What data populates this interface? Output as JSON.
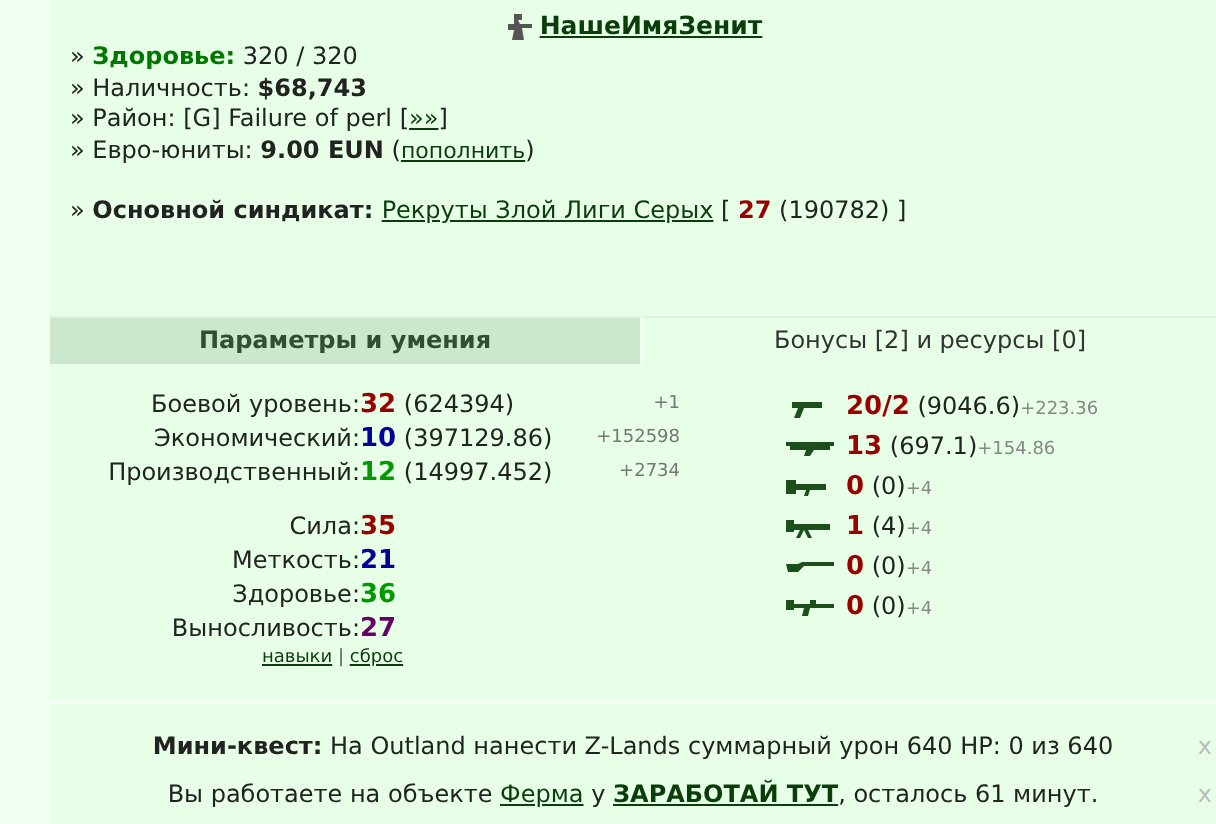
{
  "profile": {
    "name": "НашеИмяЗенит"
  },
  "info": [
    [
      {
        "kind": "label",
        "text": "Здоровье:"
      },
      {
        "kind": "text",
        "text": " 320 / 320"
      }
    ],
    [
      {
        "kind": "text",
        "text": "Наличность: "
      },
      {
        "kind": "bold",
        "text": "$68,743"
      }
    ],
    [
      {
        "kind": "text",
        "text": "Район: [G] Failure of perl ["
      },
      {
        "kind": "link",
        "text": "»»"
      },
      {
        "kind": "text",
        "text": "]"
      }
    ],
    [
      {
        "kind": "text",
        "text": "Евро-юниты: "
      },
      {
        "kind": "bold",
        "text": "9.00 EUN"
      },
      {
        "kind": "text",
        "text": " ("
      },
      {
        "kind": "smalllink",
        "text": "пополнить"
      },
      {
        "kind": "text",
        "text": ")"
      }
    ]
  ],
  "syndicate": [
    {
      "kind": "bold",
      "text": "Основной синдикат: "
    },
    {
      "kind": "link",
      "text": "Рекруты Злой Лиги Серых"
    },
    {
      "kind": "text",
      "text": " [ "
    },
    {
      "kind": "red",
      "text": "27"
    },
    {
      "kind": "text",
      "text": " (190782) ]"
    }
  ],
  "bullet": "»",
  "tabs": [
    {
      "label": "Параметры и умения",
      "selected": true
    },
    {
      "label": "Бонусы [2] и ресурсы [0]",
      "selected": false
    }
  ],
  "skills": [
    {
      "label": "Боевой уровень:",
      "value": "32",
      "color": "#990000",
      "detail": "(624394)",
      "gain": "+1"
    },
    {
      "label": "Экономический:",
      "value": "10",
      "color": "#000099",
      "detail": "(397129.86)",
      "gain": "+152598"
    },
    {
      "label": "Производственный:",
      "value": "12",
      "color": "#009900",
      "detail": "(14997.452)",
      "gain": "+2734"
    }
  ],
  "stats": [
    {
      "label": "Сила:",
      "value": "35",
      "color": "#990000"
    },
    {
      "label": "Меткость:",
      "value": "21",
      "color": "#000099"
    },
    {
      "label": "Здоровье:",
      "value": "36",
      "color": "#009900"
    },
    {
      "label": "Выносливость:",
      "value": "27",
      "color": "#660066"
    }
  ],
  "stat_links": [
    "навыки",
    "сброс"
  ],
  "stat_links_separator": "|",
  "weapons": [
    {
      "kind": "pistol",
      "value": "20/2",
      "detail": "(9046.6)",
      "gain": "+223.36"
    },
    {
      "kind": "shotgun",
      "value": "13",
      "detail": "(697.1)",
      "gain": "+154.86"
    },
    {
      "kind": "rifle",
      "value": "0",
      "detail": "(0)",
      "gain": "+4"
    },
    {
      "kind": "machinegun",
      "value": "1",
      "detail": "(4)",
      "gain": "+4"
    },
    {
      "kind": "longgun",
      "value": "0",
      "detail": "(0)",
      "gain": "+4"
    },
    {
      "kind": "heavygun",
      "value": "0",
      "detail": "(0)",
      "gain": "+4"
    }
  ],
  "notices": [
    {
      "parts": [
        {
          "kind": "bold",
          "text": "Мини-квест:"
        },
        {
          "kind": "text",
          "text": " На Outland нанести Z-Lands суммарный урон 640 HP: 0 из 640"
        }
      ],
      "close": "x"
    },
    {
      "parts": [
        {
          "kind": "text",
          "text": "Вы работаете на объекте "
        },
        {
          "kind": "link",
          "text": "Ферма"
        },
        {
          "kind": "text",
          "text": " у "
        },
        {
          "kind": "boldlink",
          "text": "ЗАРАБОТАЙ ТУТ"
        },
        {
          "kind": "text",
          "text": ", осталось 61 минут."
        }
      ],
      "close": "x"
    }
  ]
}
